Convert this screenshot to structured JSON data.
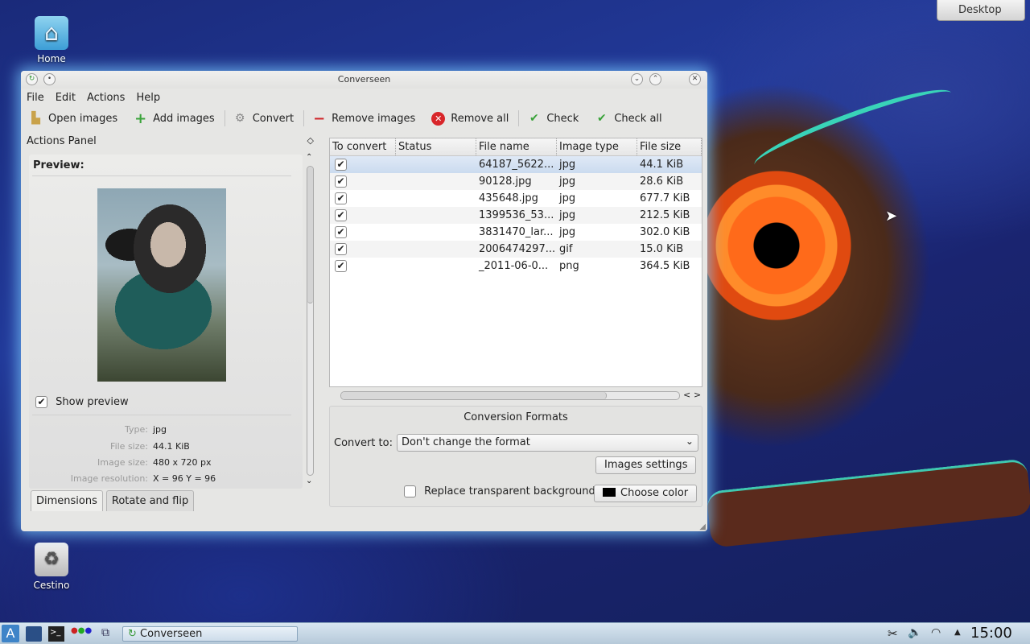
{
  "desktop": {
    "icons": [
      {
        "label": "Home"
      },
      {
        "label": "Cestino"
      }
    ],
    "desktop_button": "Desktop"
  },
  "window": {
    "title": "Converseen",
    "menu": [
      "File",
      "Edit",
      "Actions",
      "Help"
    ],
    "toolbar": {
      "open_images": "Open images",
      "add_images": "Add images",
      "convert": "Convert",
      "remove_images": "Remove images",
      "remove_all": "Remove all",
      "check": "Check",
      "check_all": "Check all"
    },
    "actions_panel": {
      "title": "Actions Panel",
      "preview_label": "Preview:",
      "show_preview": "Show preview",
      "show_preview_checked": true,
      "info": {
        "type_label": "Type:",
        "type_value": "jpg",
        "file_size_label": "File size:",
        "file_size_value": "44.1 KiB",
        "image_size_label": "Image size:",
        "image_size_value": "480 x 720 px",
        "resolution_label": "Image resolution:",
        "resolution_value": "X = 96 Y = 96"
      },
      "tabs": [
        "Dimensions",
        "Rotate and flip"
      ]
    },
    "file_list": {
      "columns": [
        "To convert",
        "Status",
        "File name",
        "Image type",
        "File size"
      ],
      "rows": [
        {
          "checked": true,
          "status": "",
          "name": "64187_5622...",
          "type": "jpg",
          "size": "44.1 KiB"
        },
        {
          "checked": true,
          "status": "",
          "name": "90128.jpg",
          "type": "jpg",
          "size": "28.6 KiB"
        },
        {
          "checked": true,
          "status": "",
          "name": "435648.jpg",
          "type": "jpg",
          "size": "677.7 KiB"
        },
        {
          "checked": true,
          "status": "",
          "name": "1399536_53...",
          "type": "jpg",
          "size": "212.5 KiB"
        },
        {
          "checked": true,
          "status": "",
          "name": "3831470_lar...",
          "type": "jpg",
          "size": "302.0 KiB"
        },
        {
          "checked": true,
          "status": "",
          "name": "2006474297...",
          "type": "gif",
          "size": "15.0 KiB"
        },
        {
          "checked": true,
          "status": "",
          "name": "_2011-06-0...",
          "type": "png",
          "size": "364.5 KiB"
        }
      ]
    },
    "conversion": {
      "title": "Conversion Formats",
      "convert_to_label": "Convert to:",
      "convert_to_value": "Don't change the format",
      "images_settings": "Images settings",
      "replace_bg": "Replace transparent background",
      "choose_color": "Choose color"
    }
  },
  "taskbar": {
    "task_label": "Converseen",
    "clock": "15:00"
  },
  "colors": {
    "window_glow": "#78c8ff",
    "selection": "#cbdbef",
    "taskbar": "#c6d7e6"
  }
}
